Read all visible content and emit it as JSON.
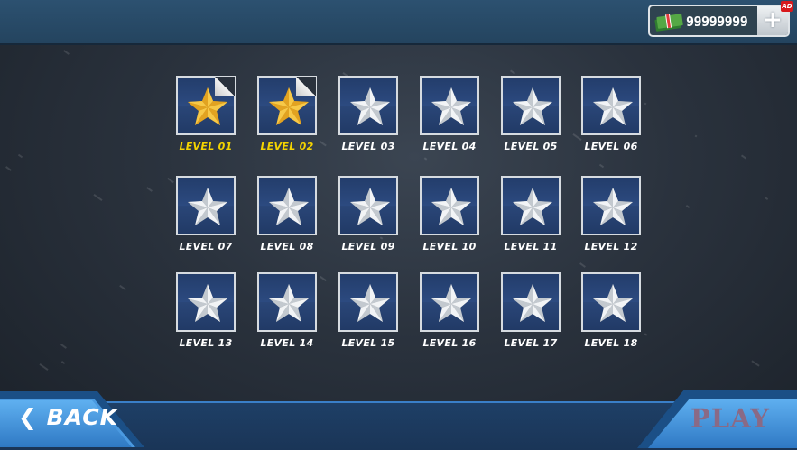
{
  "currency": {
    "amount": "99999999",
    "add_label": "+",
    "ad_badge": "AD",
    "icon": "cash-stack-icon"
  },
  "levels": [
    {
      "label": "LEVEL 01",
      "state": "unlocked",
      "star": "gold-star-icon"
    },
    {
      "label": "LEVEL 02",
      "state": "unlocked",
      "star": "gold-star-icon"
    },
    {
      "label": "LEVEL 03",
      "state": "locked",
      "star": "silver-star-icon"
    },
    {
      "label": "LEVEL 04",
      "state": "locked",
      "star": "silver-star-icon"
    },
    {
      "label": "LEVEL 05",
      "state": "locked",
      "star": "silver-star-icon"
    },
    {
      "label": "LEVEL 06",
      "state": "locked",
      "star": "silver-star-icon"
    },
    {
      "label": "LEVEL 07",
      "state": "locked",
      "star": "silver-star-icon"
    },
    {
      "label": "LEVEL 08",
      "state": "locked",
      "star": "silver-star-icon"
    },
    {
      "label": "LEVEL 09",
      "state": "locked",
      "star": "silver-star-icon"
    },
    {
      "label": "LEVEL 10",
      "state": "locked",
      "star": "silver-star-icon"
    },
    {
      "label": "LEVEL 11",
      "state": "locked",
      "star": "silver-star-icon"
    },
    {
      "label": "LEVEL 12",
      "state": "locked",
      "star": "silver-star-icon"
    },
    {
      "label": "LEVEL 13",
      "state": "locked",
      "star": "silver-star-icon"
    },
    {
      "label": "LEVEL 14",
      "state": "locked",
      "star": "silver-star-icon"
    },
    {
      "label": "LEVEL 15",
      "state": "locked",
      "star": "silver-star-icon"
    },
    {
      "label": "LEVEL 16",
      "state": "locked",
      "star": "silver-star-icon"
    },
    {
      "label": "LEVEL 17",
      "state": "locked",
      "star": "silver-star-icon"
    },
    {
      "label": "LEVEL 18",
      "state": "locked",
      "star": "silver-star-icon"
    }
  ],
  "footer": {
    "back_label": "BACK",
    "back_icon": "chevron-left-icon",
    "play_label": "PLAY"
  },
  "colors": {
    "gold_label": "#f5d400",
    "tile_blue": "#2a4678",
    "accent_blue": "#3a7fc8",
    "play_text": "#8a6a86"
  }
}
